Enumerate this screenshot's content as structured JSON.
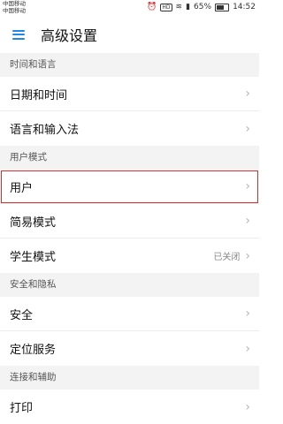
{
  "status": {
    "carrier1": "中国移动",
    "carrier2": "中国移动",
    "battery": "65%",
    "time": "14:52"
  },
  "appbar": {
    "title": "高级设置"
  },
  "sections": [
    {
      "header": "时间和语言",
      "items": [
        {
          "label": "日期和时间"
        },
        {
          "label": "语言和输入法"
        }
      ]
    },
    {
      "header": "用户模式",
      "items": [
        {
          "label": "用户"
        },
        {
          "label": "简易模式"
        },
        {
          "label": "学生模式",
          "value": "已关闭"
        }
      ]
    },
    {
      "header": "安全和隐私",
      "items": [
        {
          "label": "安全"
        },
        {
          "label": "定位服务"
        }
      ]
    },
    {
      "header": "连接和辅助",
      "items": [
        {
          "label": "打印"
        }
      ]
    }
  ]
}
